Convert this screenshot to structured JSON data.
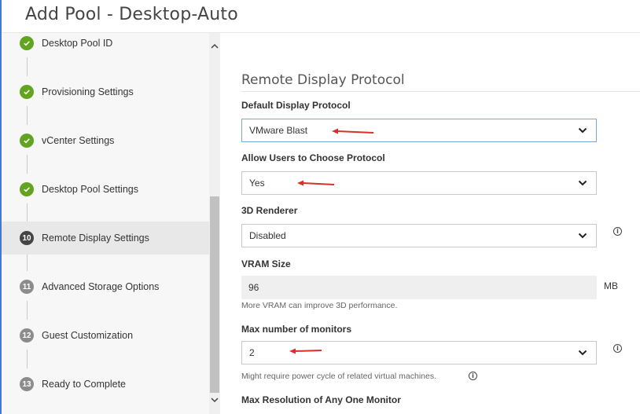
{
  "window": {
    "title": "Add Pool - Desktop-Auto"
  },
  "sidebar": {
    "steps": [
      {
        "label": "Desktop Pool ID",
        "status": "done"
      },
      {
        "label": "Provisioning Settings",
        "status": "done"
      },
      {
        "label": "vCenter Settings",
        "status": "done"
      },
      {
        "label": "Desktop Pool Settings",
        "status": "done"
      },
      {
        "label": "Remote Display Settings",
        "status": "current",
        "number": "10"
      },
      {
        "label": "Advanced Storage Options",
        "status": "pending",
        "number": "11"
      },
      {
        "label": "Guest Customization",
        "status": "pending",
        "number": "12"
      },
      {
        "label": "Ready to Complete",
        "status": "pending",
        "number": "13"
      }
    ]
  },
  "main": {
    "section_title": "Remote Display Protocol",
    "fields": {
      "default_display_protocol": {
        "label": "Default Display Protocol",
        "value": "VMware Blast"
      },
      "allow_users_choose": {
        "label": "Allow Users to Choose Protocol",
        "value": "Yes"
      },
      "renderer_3d": {
        "label": "3D Renderer",
        "value": "Disabled"
      },
      "vram_size": {
        "label": "VRAM Size",
        "value": "96",
        "unit": "MB",
        "hint": "More VRAM can improve 3D performance."
      },
      "max_monitors": {
        "label": "Max number of monitors",
        "value": "2",
        "hint": "Might require power cycle of related virtual machines."
      },
      "max_resolution": {
        "label": "Max Resolution of Any One Monitor"
      }
    }
  },
  "colors": {
    "accent_blue": "#4a78c8",
    "done_green": "#62a420",
    "annotation_red": "#d9302a"
  }
}
